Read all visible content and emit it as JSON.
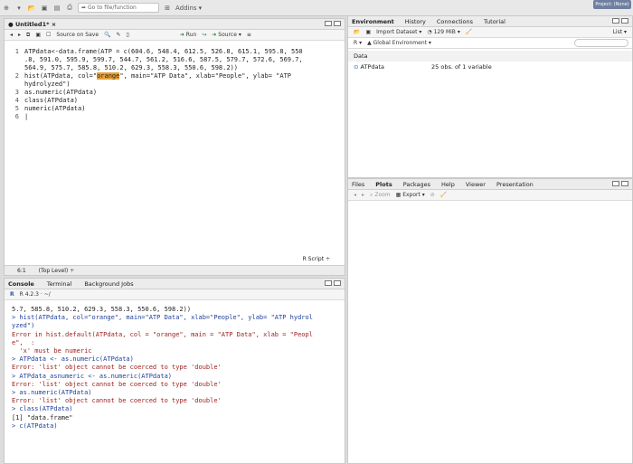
{
  "toolbar": {
    "goto_placeholder": "Go to file/function",
    "addins": "Addins",
    "project": "Project: (None)"
  },
  "editor": {
    "tab": "Untitled1*",
    "source_on_save": "Source on Save",
    "run": "Run",
    "source": "Source",
    "lines": [
      {
        "n": "1",
        "text": "ATPdata<-data.frame(ATP = c(604.6, 548.4, 612.5, 526.8, 615.1, 595.8, 550"
      },
      {
        "n": "",
        "text": ".8, 591.0, 595.9, 599.7, 544.7, 561.2, 516.6, 587.5, 579.7, 572.6, 569.7,"
      },
      {
        "n": "",
        "text": "564.9, 575.7, 585.8, 510.2, 629.3, 558.3, 550.6, 598.2))"
      },
      {
        "n": "2",
        "pre": "hist(ATPdata, col=\"",
        "hl": "orange",
        "post": "\", main=\"ATP Data\", xlab=\"People\", ylab= \"ATP"
      },
      {
        "n": "",
        "text": "hydrolyzed\")"
      },
      {
        "n": "3",
        "text": "as.numeric(ATPdata)"
      },
      {
        "n": "4",
        "text": "class(ATPdata)"
      },
      {
        "n": "5",
        "text": "numeric(ATPdata)"
      },
      {
        "n": "6",
        "text": "|"
      }
    ],
    "position": "6:1",
    "scope": "(Top Level)",
    "filetype": "R Script"
  },
  "console": {
    "tabs": [
      "Console",
      "Terminal",
      "Background Jobs"
    ],
    "version": "R 4.2.3 · ~/",
    "lines": [
      {
        "k": "o",
        "t": "5.7, 585.8, 510.2, 629.3, 558.3, 550.6, 598.2))"
      },
      {
        "k": "p",
        "t": "> hist(ATPdata, col=\"orange\", main=\"ATP Data\", xlab=\"People\", ylab= \"ATP hydrol"
      },
      {
        "k": "p",
        "t": "yzed\")"
      },
      {
        "k": "e",
        "t": "Error in hist.default(ATPdata, col = \"orange\", main = \"ATP Data\", xlab = \"Peopl"
      },
      {
        "k": "e",
        "t": "e\",  :"
      },
      {
        "k": "e",
        "t": "  'x' must be numeric"
      },
      {
        "k": "p",
        "t": "> ATPdata <- as.numeric(ATPdata)"
      },
      {
        "k": "e",
        "t": "Error: 'list' object cannot be coerced to type 'double'"
      },
      {
        "k": "p",
        "t": "> ATPdata_asnumeric <- as.numeric(ATPdata)"
      },
      {
        "k": "e",
        "t": "Error: 'list' object cannot be coerced to type 'double'"
      },
      {
        "k": "p",
        "t": "> as.numeric(ATPdata)"
      },
      {
        "k": "e",
        "t": "Error: 'list' object cannot be coerced to type 'double'"
      },
      {
        "k": "p",
        "t": "> class(ATPdata)"
      },
      {
        "k": "o",
        "t": "[1] \"data.frame\""
      },
      {
        "k": "p",
        "t": "> c(ATPdata)"
      }
    ]
  },
  "env": {
    "tabs": [
      "Environment",
      "History",
      "Connections",
      "Tutorial"
    ],
    "import": "Import Dataset",
    "memory": "129 MiB",
    "list": "List",
    "lang": "R",
    "scope": "Global Environment",
    "section": "Data",
    "var_name": "ATPdata",
    "var_value": "25 obs. of 1 variable"
  },
  "files": {
    "tabs": [
      "Files",
      "Plots",
      "Packages",
      "Help",
      "Viewer",
      "Presentation"
    ],
    "zoom": "Zoom",
    "export": "Export"
  }
}
